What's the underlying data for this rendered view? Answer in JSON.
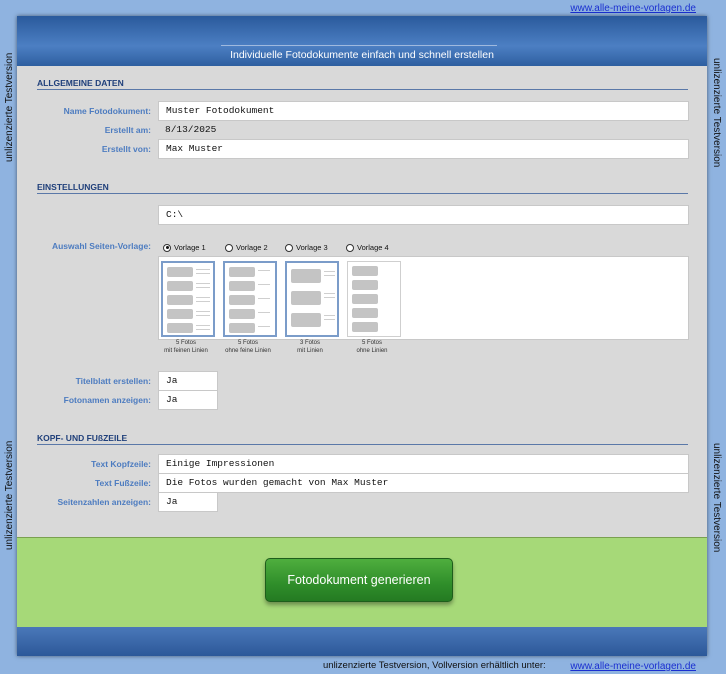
{
  "links": {
    "top": "www.alle-meine-vorlagen.de",
    "bottom_note": "unlizenzierte Testversion, Vollversion erhältlich unter:",
    "bottom": "www.alle-meine-vorlagen.de"
  },
  "watermark": "unlizenzierte Testversion",
  "header": {
    "subtitle": "Individuelle Fotodokumente einfach und schnell erstellen"
  },
  "general": {
    "title": "ALLGEMEINE DATEN",
    "name_label": "Name Fotodokument:",
    "name_value": "Muster Fotodokument",
    "created_label": "Erstellt am:",
    "created_value": "8/13/2025",
    "author_label": "Erstellt von:",
    "author_value": "Max Muster"
  },
  "settings": {
    "title": "EINSTELLUNGEN",
    "path_value": "C:\\",
    "template_label": "Auswahl Seiten-Vorlage:",
    "templates": [
      {
        "label": "Vorlage 1",
        "selected": true,
        "caption1": "5  Fotos",
        "caption2": "mit feinen Linien"
      },
      {
        "label": "Vorlage 2",
        "selected": false,
        "caption1": "5  Fotos",
        "caption2": "ohne feine Linien"
      },
      {
        "label": "Vorlage 3",
        "selected": false,
        "caption1": "3 Fotos",
        "caption2": "mit Linien"
      },
      {
        "label": "Vorlage 4",
        "selected": false,
        "caption1": "5 Fotos",
        "caption2": "ohne Linien"
      }
    ],
    "titlepage_label": "Titelblatt erstellen:",
    "titlepage_value": "Ja",
    "photonames_label": "Fotonamen anzeigen:",
    "photonames_value": "Ja"
  },
  "headerfooter": {
    "title": "KOPF- UND FUßZEILE",
    "header_label": "Text Kopfzeile:",
    "header_value": "Einige Impressionen",
    "footer_label": "Text Fußzeile:",
    "footer_value": "Die Fotos wurden gemacht von Max Muster",
    "pagenums_label": "Seitenzahlen anzeigen:",
    "pagenums_value": "Ja"
  },
  "actions": {
    "generate_label": "Fotodokument generieren"
  }
}
